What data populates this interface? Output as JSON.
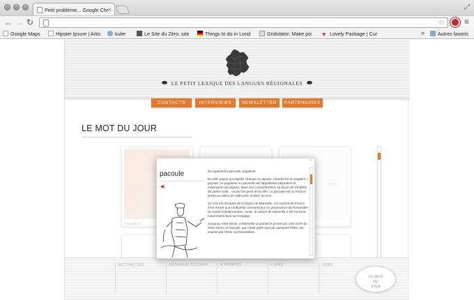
{
  "browser": {
    "tab_title": "Petit problème... Google Chr",
    "tab_close": "×",
    "url": "",
    "bookmarks": [
      {
        "label": "Google Maps"
      },
      {
        "label": "Hipster Ipsum | Artis"
      },
      {
        "label": "kuler"
      },
      {
        "label": "Le Site du Zéro, site"
      },
      {
        "label": "Things to do in Lond"
      },
      {
        "label": "Gridulator: Make pix"
      },
      {
        "label": "Lovely Package | Cur"
      }
    ],
    "bookmarks_more": "»",
    "other_bookmarks": "Autres favoris"
  },
  "site": {
    "title": "LE PETIT LEXIQUE DES LANGUES RÉGIONALES",
    "nav": [
      "CONTACTS",
      "INTERVIEWS",
      "NEWSLETTER",
      "PARTENAIRES"
    ],
    "heading": "LE MOT DU JOUR",
    "card_ghosts": [
      "pacou",
      "",
      "nter"
    ],
    "card_caps": [
      "Pacoule 14",
      "",
      ""
    ],
    "footer": [
      "ACTUALITÉS",
      "RÉSEAUX SOCIAUX",
      "À PROPOS",
      "LIENS",
      "JOBS"
    ],
    "bubble_line1": "LE MOT",
    "bubble_line2": "DU",
    "bubble_line3": "JOUR"
  },
  "popup": {
    "close": "×",
    "word": "pacoule",
    "audio": "◀)",
    "definition": [
      "Ou également pacoulin, pagalenti.",
      "Du latin pagus qui signifie champs ou agraire, transformé en pagalen « paysan. Le pagalenti ou pacoulin est l'appellation péjorative et méprisante du paysan, dans son comportement, sa façon de s'habiller de parler mais... vu par les gens de la ville. La pacoule est un endroit perdu au milieu de nulle part, le bled, la zone.",
      "Ce mot est d'origine de la région de Marseille. Cet endroit de France s'est trouvé aux confluents commerciaux en provenance de l'ensemble du bassin méditerranéen. Aussi, la culture de Marseille a été enrichie, notamment dans son langage.",
      "Jusqu'au XIXe siècle, à Marseille on parlait le provençal. Vers la fin du XIXe siècle, le français, qui n'était parlé que par quelques élites, est imposé par l'Etat. Les Marseillais"
    ]
  },
  "colors": {
    "accent": "#e07a2e",
    "text": "#222222"
  },
  "icons": [
    "back-arrow-icon",
    "forward-arrow-icon",
    "reload-icon",
    "star-icon",
    "menu-icon",
    "france-map-icon",
    "audio-icon"
  ]
}
